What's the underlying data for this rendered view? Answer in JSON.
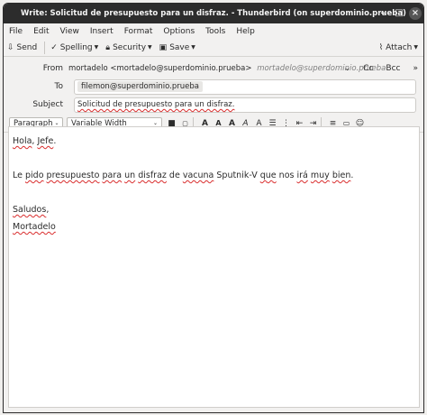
{
  "window": {
    "title": "Write: Solicitud de presupuesto para un disfraz. - Thunderbird (on superdominio.prueba)"
  },
  "menu": [
    "File",
    "Edit",
    "View",
    "Insert",
    "Format",
    "Options",
    "Tools",
    "Help"
  ],
  "toolbar": {
    "send": "Send",
    "spelling": "Spelling",
    "security": "Security",
    "save": "Save",
    "attach": "Attach"
  },
  "header": {
    "from_label": "From",
    "from_value": "mortadelo <mortadelo@superdominio.prueba>",
    "from_identity": "mortadelo@superdominio.prueba",
    "cc": "Cc",
    "bcc": "Bcc",
    "to_label": "To",
    "to_value": "filemon@superdominio.prueba",
    "subject_label": "Subject",
    "subject_value": "Solicitud de presupuesto para un disfraz."
  },
  "format": {
    "paragraph": "Paragraph",
    "font": "Variable Width"
  },
  "body": {
    "line1_a": "Hola",
    "line1_b": ", ",
    "line1_c": "Jefe",
    "line1_d": ".",
    "line2": [
      {
        "t": "Le ",
        "s": false
      },
      {
        "t": "pido",
        "s": true
      },
      {
        "t": " ",
        "s": false
      },
      {
        "t": "presupuesto",
        "s": true
      },
      {
        "t": " ",
        "s": false
      },
      {
        "t": "para",
        "s": true
      },
      {
        "t": " ",
        "s": false
      },
      {
        "t": "un",
        "s": true
      },
      {
        "t": " ",
        "s": false
      },
      {
        "t": "disfraz",
        "s": true
      },
      {
        "t": " de ",
        "s": false
      },
      {
        "t": "vacuna",
        "s": true
      },
      {
        "t": " Sputnik-V ",
        "s": false
      },
      {
        "t": "que",
        "s": true
      },
      {
        "t": " nos ",
        "s": false
      },
      {
        "t": "irá",
        "s": true
      },
      {
        "t": " ",
        "s": false
      },
      {
        "t": "muy",
        "s": true
      },
      {
        "t": " ",
        "s": false
      },
      {
        "t": "bien",
        "s": true
      },
      {
        "t": ".",
        "s": false
      }
    ],
    "line3": "Saludos",
    "line3_punct": ",",
    "line4": "Mortadelo"
  },
  "colors": {
    "titlebar": "#2c2c2c",
    "spell_underline": "#d92e2e"
  }
}
